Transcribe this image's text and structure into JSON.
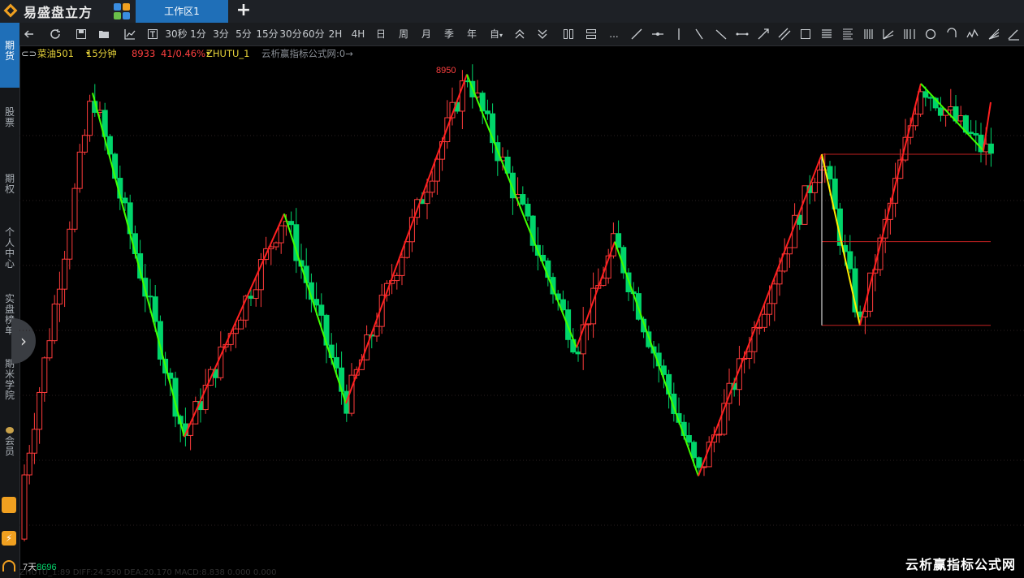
{
  "app": {
    "name": "易盛盘立方"
  },
  "tabs": [
    {
      "label": "工作区1"
    }
  ],
  "toolbar": {
    "periods": [
      "30秒",
      "1分",
      "3分",
      "5分",
      "15分",
      "30分",
      "60分",
      "2H",
      "4H",
      "日",
      "周",
      "月",
      "季",
      "年",
      "自"
    ],
    "ellipsis": "..."
  },
  "sidebar": {
    "items": [
      {
        "label": "期货",
        "active": true
      },
      {
        "label": "股票"
      },
      {
        "label": "期权"
      },
      {
        "label": "个人中心"
      },
      {
        "label": "实盘榜单"
      },
      {
        "label": "期米学院"
      },
      {
        "label": "会员"
      }
    ]
  },
  "info": {
    "symbol": "菜油501",
    "period": "15分钟",
    "price": "8933",
    "change": "41/0.46%",
    "indicator": "ZHUTU_1",
    "note": "云析赢指标公式网:0→"
  },
  "colors": {
    "up": "#ff3b3b",
    "down": "#00d56a",
    "zigzag_up": "#ff2020",
    "zigzag_down": "#40ff00",
    "highlight": "#ffee00",
    "accent": "#1f6fb8"
  },
  "chart_data": {
    "type": "candlestick",
    "high_label": "8950",
    "low_label": "8696",
    "zigzag_points": [
      8718,
      8940,
      8755,
      8875,
      8773,
      8950,
      8803,
      8860,
      8734,
      8907,
      8815,
      8945,
      8909
    ],
    "note_low_prefix": "7天"
  },
  "watermark": "云析赢指标公式网",
  "bottom_text": "ZHUTU_1:89  DIFF:24.590  DEA:20.170  MACD:8.838  0.000  0.000"
}
